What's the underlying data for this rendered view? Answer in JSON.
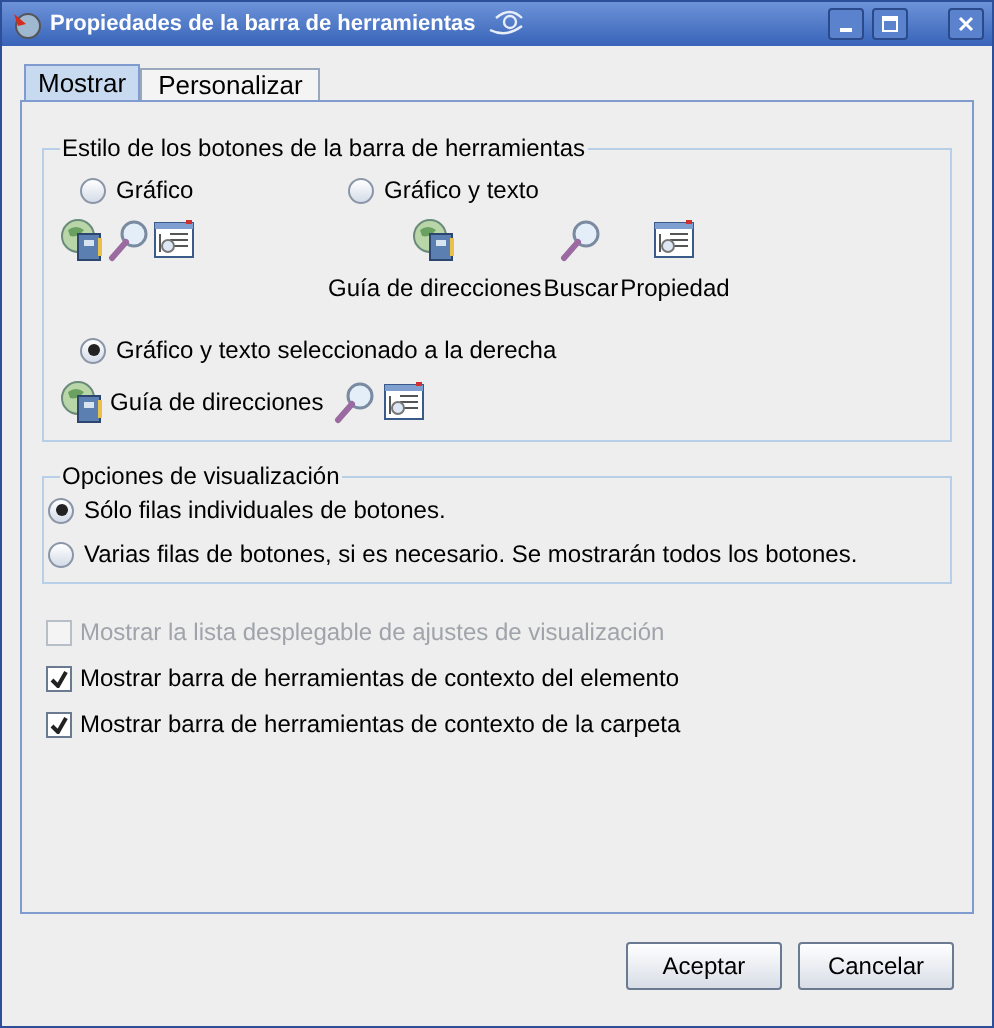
{
  "window": {
    "title": "Propiedades de la barra de herramientas"
  },
  "tabs": [
    {
      "label": "Mostrar",
      "selected": true
    },
    {
      "label": "Personalizar",
      "selected": false
    }
  ],
  "button_style": {
    "title": "Estilo de los botones de la barra de herramientas",
    "options": [
      {
        "label": "Gráfico",
        "selected": false,
        "kind": "icons"
      },
      {
        "label": "Gráfico y texto",
        "selected": false,
        "kind": "below",
        "captions": [
          "Guía de direcciones",
          "Buscar",
          "Propiedad"
        ]
      },
      {
        "label": "Gráfico y texto seleccionado a la derecha",
        "selected": true,
        "kind": "right",
        "captions": [
          "Guía de direcciones"
        ]
      }
    ]
  },
  "display_options": {
    "title": "Opciones de visualización",
    "options": [
      {
        "label": "Sólo filas individuales de botones.",
        "selected": true
      },
      {
        "label": "Varias filas de botones, si es necesario. Se mostrarán todos los botones.",
        "selected": false
      }
    ]
  },
  "checkboxes": [
    {
      "label": "Mostrar la lista desplegable de ajustes de visualización",
      "checked": false,
      "disabled": true
    },
    {
      "label": "Mostrar barra de herramientas de contexto del elemento",
      "checked": true,
      "disabled": false
    },
    {
      "label": "Mostrar barra de herramientas de contexto de la carpeta",
      "checked": true,
      "disabled": false
    }
  ],
  "buttons": [
    {
      "label": "Aceptar"
    },
    {
      "label": "Cancelar"
    }
  ]
}
